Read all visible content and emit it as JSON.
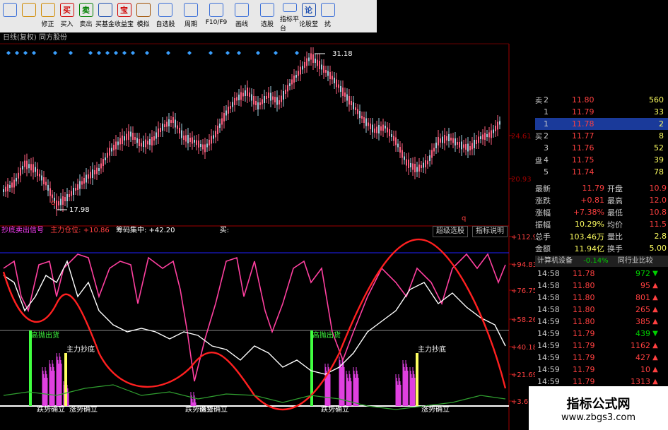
{
  "toolbar": {
    "buttons": [
      {
        "label": "",
        "icon": "back-icon",
        "color": "#3a6fd8"
      },
      {
        "label": "",
        "icon": "up-down-icon",
        "color": "#d08a00"
      },
      {
        "label": "修正",
        "icon": "fix-icon",
        "color": "#d08a00"
      },
      {
        "label": "买入",
        "icon": "buy-icon",
        "color": "#d00000",
        "glyph": "买"
      },
      {
        "label": "卖出",
        "icon": "sell-icon",
        "color": "#008000",
        "glyph": "卖"
      },
      {
        "label": "买基金",
        "icon": "fund-icon",
        "color": "#1d4fb0"
      },
      {
        "label": "收益宝",
        "icon": "bao-icon",
        "color": "#d00000",
        "glyph": "宝"
      },
      {
        "label": "模拟",
        "icon": "hammer-icon",
        "color": "#a05000"
      },
      {
        "label": "自选股",
        "icon": "star-icon",
        "color": "#3a6fd8"
      },
      {
        "label": "周期",
        "icon": "clock-icon",
        "color": "#3a6fd8"
      },
      {
        "label": "F10/F9",
        "icon": "f10-icon",
        "color": "#3a6fd8"
      },
      {
        "label": "画线",
        "icon": "pen-icon",
        "color": "#3a6fd8"
      },
      {
        "label": "选股",
        "icon": "select-icon",
        "color": "#3a6fd8"
      },
      {
        "label": "指标平台",
        "icon": "platform-icon",
        "color": "#3a6fd8"
      },
      {
        "label": "论股堂",
        "icon": "forum-icon",
        "color": "#1d4fb0",
        "glyph": "论"
      },
      {
        "label": "扰",
        "icon": "more-icon",
        "color": "#3a6fd8"
      }
    ]
  },
  "chart_title": "日线(复权)   同方股份",
  "price_chart": {
    "high_label": "31.18",
    "low_label": "17.98",
    "axis_labels": [
      "24.61",
      "20.93"
    ],
    "markers": [
      "q",
      "q"
    ]
  },
  "indicator_header": {
    "name": "抄底卖出信号",
    "main_label": "主力仓位:",
    "main_value": "+10.86",
    "chip_label": "筹码集中:",
    "chip_value": "+42.20",
    "buy_label": "买:",
    "tab1": "超级选股",
    "tab2": "指标说明"
  },
  "indicator_axis": [
    "+112.9",
    "+94.83",
    "+76.75",
    "+58.26",
    "+40.18",
    "+21.69",
    "+3.61"
  ],
  "indicator_labels": {
    "top_signal": "高抛出货",
    "bottom_signal": "主力抄底",
    "trend_down": "跌势确立",
    "trend_up": "涨势确立"
  },
  "order_book": [
    {
      "side": "卖",
      "level": "2",
      "price": "11.80",
      "vol": "560"
    },
    {
      "side": "",
      "level": "1",
      "price": "11.79",
      "vol": "33"
    },
    {
      "side": "",
      "level": "1",
      "price": "11.78",
      "vol": "2"
    },
    {
      "side": "买",
      "level": "2",
      "price": "11.77",
      "vol": "8"
    },
    {
      "side": "",
      "level": "3",
      "price": "11.76",
      "vol": "52"
    },
    {
      "side": "盘",
      "level": "4",
      "price": "11.75",
      "vol": "39"
    },
    {
      "side": "",
      "level": "5",
      "price": "11.74",
      "vol": "78"
    }
  ],
  "stats": [
    {
      "k1": "最新",
      "v1": "11.79",
      "k2": "开盘",
      "v2": "10.9"
    },
    {
      "k1": "涨跌",
      "v1": "+0.81",
      "k2": "最高",
      "v2": "12.0"
    },
    {
      "k1": "涨幅",
      "v1": "+7.38%",
      "k2": "最低",
      "v2": "10.8"
    },
    {
      "k1": "振幅",
      "v1": "10.29%",
      "k2": "均价",
      "v2": "11.5"
    },
    {
      "k1": "总手",
      "v1": "103.46万",
      "k2": "量比",
      "v2": "2.8"
    },
    {
      "k1": "金额",
      "v1": "11.94亿",
      "k2": "换手",
      "v2": "5.00"
    }
  ],
  "sector": {
    "name": "计算机设备",
    "change": "-0.14%",
    "link": "同行业比较"
  },
  "ticks": [
    {
      "time": "14:58",
      "price": "11.78",
      "vol": "972",
      "dir": "down"
    },
    {
      "time": "14:58",
      "price": "11.80",
      "vol": "95",
      "dir": "up"
    },
    {
      "time": "14:58",
      "price": "11.80",
      "vol": "801",
      "dir": "up"
    },
    {
      "time": "14:58",
      "price": "11.80",
      "vol": "265",
      "dir": "up"
    },
    {
      "time": "14:59",
      "price": "11.80",
      "vol": "385",
      "dir": "up"
    },
    {
      "time": "14:59",
      "price": "11.79",
      "vol": "439",
      "dir": "down"
    },
    {
      "time": "14:59",
      "price": "11.79",
      "vol": "1162",
      "dir": "up"
    },
    {
      "time": "14:59",
      "price": "11.79",
      "vol": "427",
      "dir": "up"
    },
    {
      "time": "14:59",
      "price": "11.79",
      "vol": "10",
      "dir": "up"
    },
    {
      "time": "14:59",
      "price": "11.79",
      "vol": "1313",
      "dir": "up"
    }
  ],
  "watermark": {
    "line1": "指标公式网",
    "line2": "www.zbgs3.com"
  },
  "colors": {
    "up": "#ff3030",
    "down": "#00d000",
    "price": "#ffff00",
    "bg": "#000000",
    "axis": "#c00000"
  }
}
